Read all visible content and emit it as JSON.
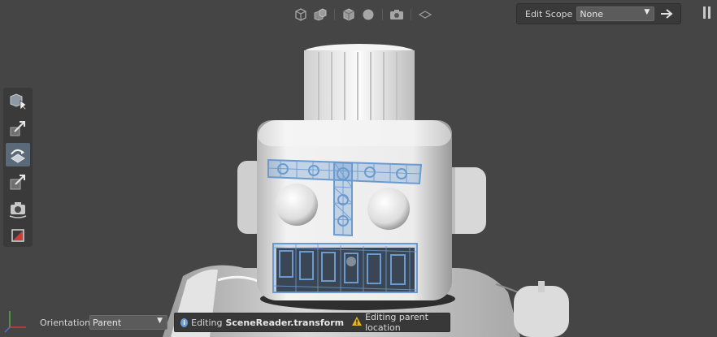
{
  "toolbar": {
    "icons": [
      "selection-mask-icon",
      "drawing-mode-icon",
      "wireframe-icon",
      "shading-icon",
      "camera-icon",
      "grid-icon"
    ]
  },
  "edit_scope": {
    "label": "Edit Scope",
    "value": "None"
  },
  "left_tools": {
    "icons": [
      "select-tool-icon",
      "translate-tool-icon",
      "rotate-tool-icon",
      "scale-tool-icon",
      "camera-tool-icon",
      "crop-window-tool-icon"
    ],
    "active_index": 2
  },
  "bottom": {
    "orientation_label": "Orientation",
    "orientation_value": "Parent"
  },
  "status": {
    "editing_prefix": "Editing",
    "editing_target": "SceneReader.transform",
    "warning_text": "Editing parent location"
  },
  "colors": {
    "background": "#454545",
    "wire_blue": "#6b9ad0",
    "active_tool": "#5a6a78",
    "axis_red": "#d23a3a",
    "axis_green": "#4caf50",
    "axis_blue": "#4a73d8"
  }
}
